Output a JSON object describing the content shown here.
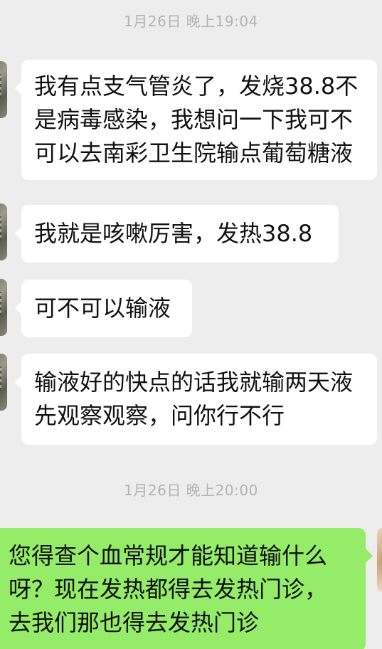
{
  "timestamps": [
    "1月26日 晚上19:04",
    "1月26日 晚上20:00"
  ],
  "messages": [
    {
      "direction": "incoming",
      "lines": [
        "我有点支气管炎了，发烧38.8不",
        "是病毒感染，我想问一下我可不",
        "可以去南彩卫生院输点葡萄糖液"
      ]
    },
    {
      "direction": "incoming",
      "lines": [
        "我就是咳嗽厉害，发热38.8"
      ]
    },
    {
      "direction": "incoming",
      "lines": [
        "可不可以输液"
      ]
    },
    {
      "direction": "incoming",
      "lines": [
        "输液好的快点的话我就输两天液",
        "先观察观察，问你行不行"
      ]
    },
    {
      "direction": "outgoing",
      "lines": [
        "您得查个血常规才能知道输什么",
        "呀？现在发热都得去发热门诊，",
        "去我们那也得去发热门诊"
      ]
    }
  ],
  "colors": {
    "background": "#ededed",
    "incoming_bubble": "#ffffff",
    "outgoing_bubble": "#95ec69",
    "timestamp_text": "#b3b3b3"
  },
  "icons": {
    "contact_avatar": "avatar-icon",
    "self_avatar": "avatar-icon"
  }
}
